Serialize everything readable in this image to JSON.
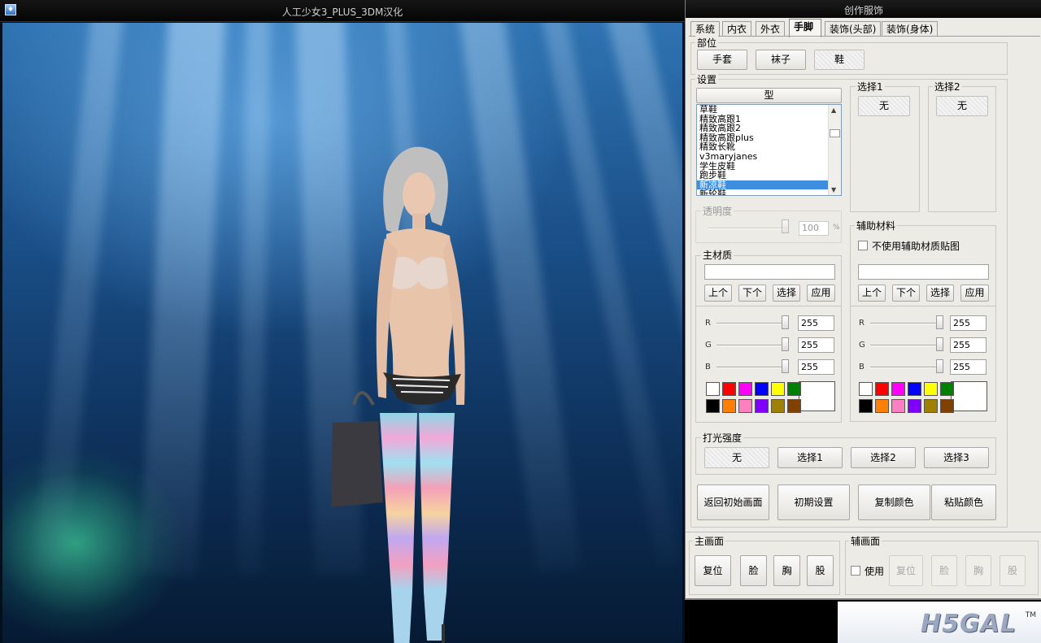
{
  "game": {
    "title": "人工少女3_PLUS_3DM汉化",
    "icon": "app-icon"
  },
  "editor": {
    "title": "创作服饰",
    "tabs": [
      "系统",
      "内衣",
      "外衣",
      "手脚",
      "装饰(头部)",
      "装饰(身体)"
    ],
    "active_tab": "手脚",
    "part": {
      "label": "部位",
      "buttons": [
        "手套",
        "袜子",
        "鞋"
      ],
      "selected": "鞋"
    },
    "settings": {
      "label": "设置",
      "type_header": "型",
      "list": [
        "草鞋",
        "精致高跟1",
        "精致高跟2",
        "精致高跟plus",
        "精致长靴",
        "v3maryjanes",
        "学生皮鞋",
        "跑步鞋",
        "新凉鞋",
        "新轮鞋"
      ],
      "selected": "新凉鞋",
      "select1": {
        "label": "选择1",
        "value": "无"
      },
      "select2": {
        "label": "选择2",
        "value": "无"
      },
      "transparency": {
        "label": "透明度",
        "value": "100",
        "unit": "%"
      }
    },
    "main_material": {
      "label": "主材质",
      "value": "",
      "buttons": [
        "上个",
        "下个",
        "选择",
        "应用"
      ],
      "channels": [
        {
          "name": "R",
          "value": "255"
        },
        {
          "name": "G",
          "value": "255"
        },
        {
          "name": "B",
          "value": "255"
        }
      ],
      "preview_color": "#ffffff"
    },
    "aux_material": {
      "label": "辅助材料",
      "checkbox_label": "不使用辅助材质贴图",
      "value": "",
      "buttons": [
        "上个",
        "下个",
        "选择",
        "应用"
      ],
      "channels": [
        {
          "name": "R",
          "value": "255"
        },
        {
          "name": "G",
          "value": "255"
        },
        {
          "name": "B",
          "value": "255"
        }
      ],
      "preview_color": "#ffffff"
    },
    "palette": [
      "#ffffff",
      "#ff0000",
      "#ff00ff",
      "#0000ff",
      "#ffff00",
      "#008000",
      "#000000",
      "#ff8000",
      "#ff80c0",
      "#8000ff",
      "#a08000",
      "#804000"
    ],
    "lighting": {
      "label": "打光强度",
      "buttons": [
        "无",
        "选择1",
        "选择2",
        "选择3"
      ],
      "selected": "无"
    },
    "actions": [
      "返回初始画面",
      "初期设置",
      "复制颜色",
      "粘贴颜色"
    ],
    "main_view": {
      "label": "主画面",
      "buttons": [
        "复位",
        "脸",
        "胸",
        "股"
      ]
    },
    "aux_view": {
      "label": "辅画面",
      "checkbox_label": "使用",
      "buttons": [
        "复位",
        "脸",
        "胸",
        "股"
      ]
    }
  },
  "watermark": {
    "text": "H5GAL",
    "tm": "TM"
  }
}
